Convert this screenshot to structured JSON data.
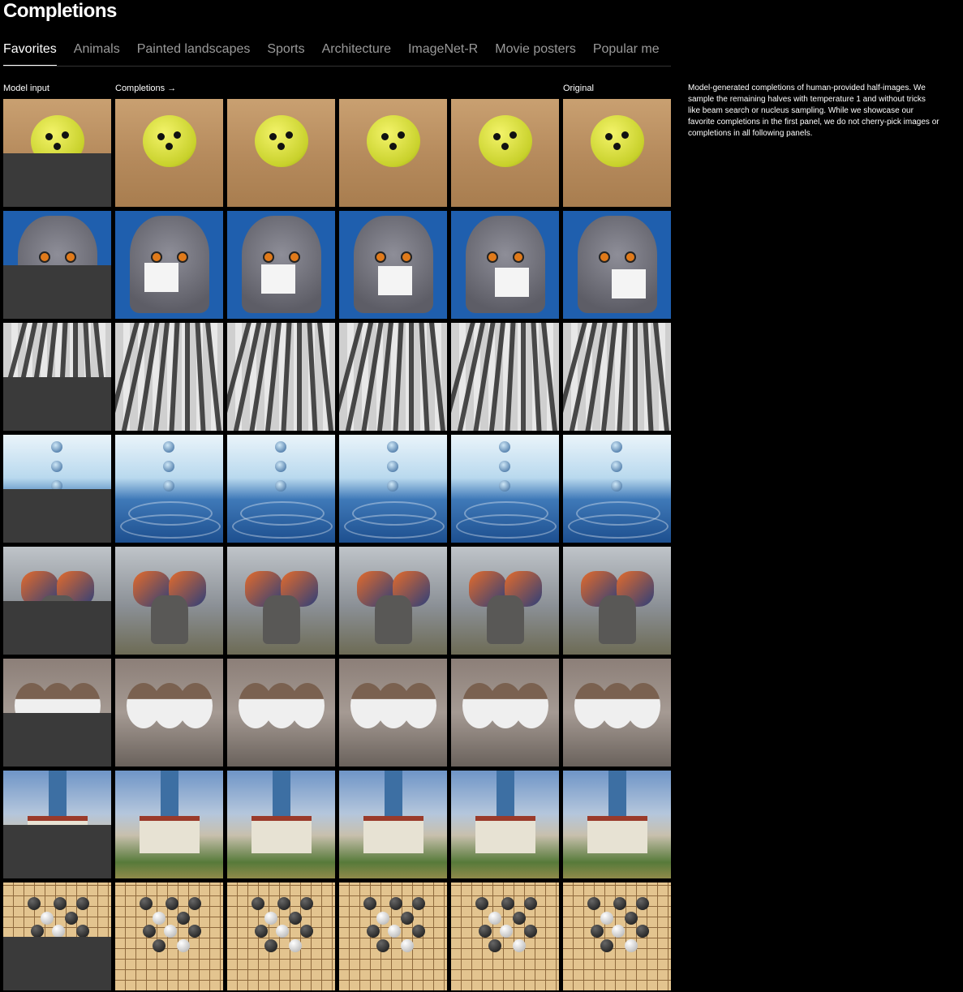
{
  "page": {
    "title": "Completions"
  },
  "tabs": [
    {
      "label": "Favorites",
      "active": true
    },
    {
      "label": "Animals",
      "active": false
    },
    {
      "label": "Painted landscapes",
      "active": false
    },
    {
      "label": "Sports",
      "active": false
    },
    {
      "label": "Architecture",
      "active": false
    },
    {
      "label": "ImageNet-R",
      "active": false
    },
    {
      "label": "Movie posters",
      "active": false
    },
    {
      "label": "Popular me",
      "active": false
    }
  ],
  "columns": {
    "model_input": "Model input",
    "completions": "Completions →",
    "original": "Original"
  },
  "description": "Model-generated completions of human-provided half-images. We sample the remaining halves with temperature 1 and without tricks like beam search or nucleus sampling. While we showcase our favorite completions in the first panel, we do not cherry-pick images or completions in all following panels.",
  "rows": [
    {
      "subject": "tennis-ball-chick",
      "style": "s1"
    },
    {
      "subject": "cat-holding-card",
      "style": "s2"
    },
    {
      "subject": "crosswalk-shadows",
      "style": "s3"
    },
    {
      "subject": "water-drop",
      "style": "s4"
    },
    {
      "subject": "butterfly-elephant",
      "style": "s5"
    },
    {
      "subject": "three-birds",
      "style": "s6"
    },
    {
      "subject": "tower-painting",
      "style": "s7"
    },
    {
      "subject": "go-board",
      "style": "s8"
    }
  ],
  "cells_per_row": [
    "model-input",
    "completion-1",
    "completion-2",
    "completion-3",
    "completion-4",
    "original"
  ]
}
